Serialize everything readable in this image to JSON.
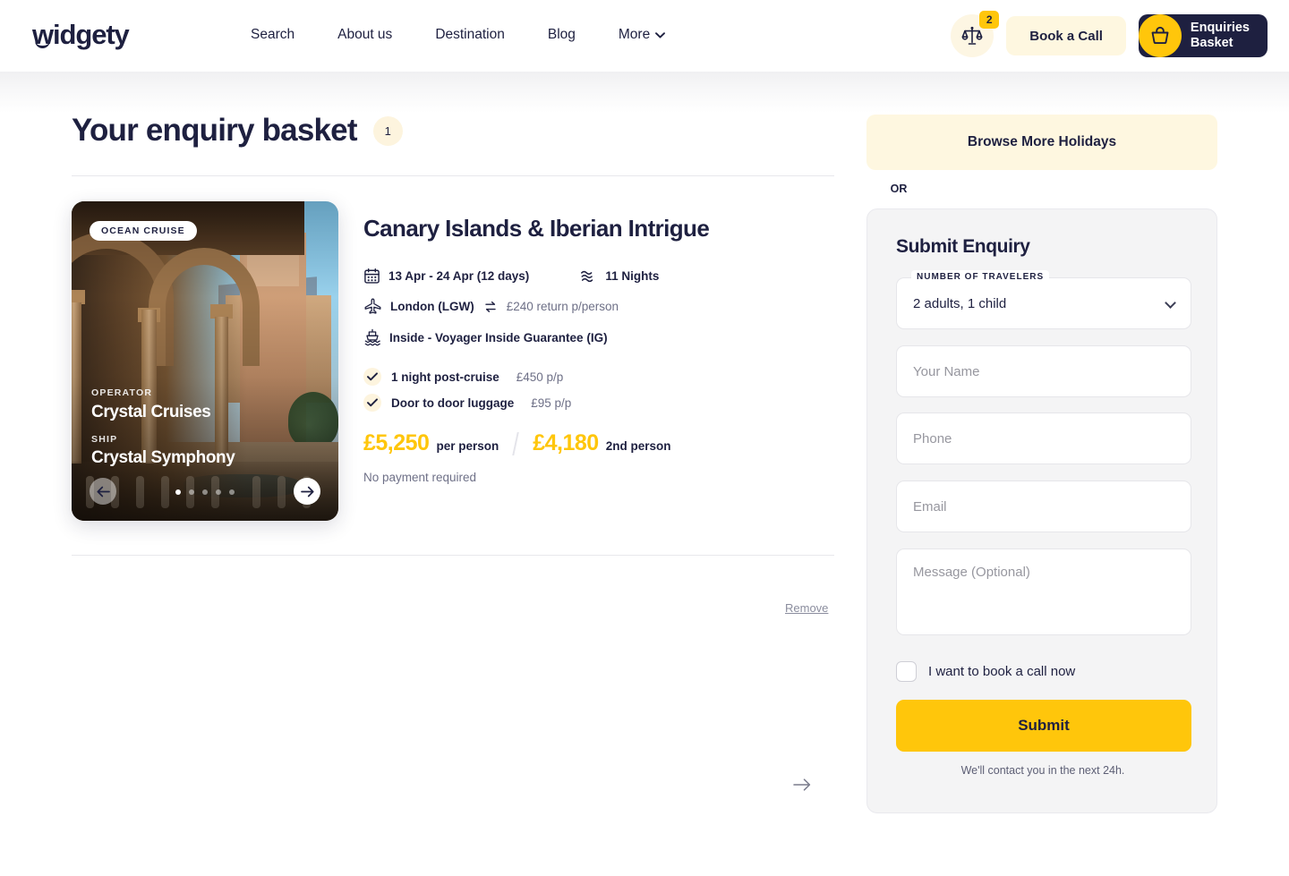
{
  "header": {
    "logo_text": "widgety",
    "nav": [
      {
        "label": "Search",
        "has_chevron": false
      },
      {
        "label": "About us",
        "has_chevron": false
      },
      {
        "label": "Destination",
        "has_chevron": false
      },
      {
        "label": "Blog",
        "has_chevron": false
      },
      {
        "label": "More",
        "has_chevron": true
      }
    ],
    "compare": {
      "icon": "scales-icon",
      "badge_count": "2"
    },
    "book_call_label": "Book a Call",
    "basket": {
      "icon": "basket-icon",
      "line1": "Enquiries",
      "line2": "Basket"
    }
  },
  "main": {
    "page_title": "Your enquiry basket",
    "item_count": "1",
    "next_arrow_icon": "arrow-right-icon"
  },
  "trip": {
    "badge": "OCEAN CRUISE",
    "operator_label": "OPERATOR",
    "operator": "Crystal Cruises",
    "ship_label": "SHIP",
    "ship": "Crystal Symphony",
    "carousel": {
      "total_dots": 5,
      "active_index": 0,
      "prev_icon": "arrow-left-icon",
      "next_icon": "arrow-right-icon"
    },
    "title": "Canary Islands & Iberian Intrigue",
    "dates": "13 Apr - 24 Apr (12 days)",
    "nights": "11 Nights",
    "flight_airport": "London (LGW)",
    "flight_price": "£240 return p/person",
    "cabin": "Inside - Voyager Inside Guarantee (IG)",
    "addons": [
      {
        "name": "1 night post-cruise",
        "price": "£450 p/p"
      },
      {
        "name": "Door to door luggage",
        "price": "£95 p/p"
      }
    ],
    "price_main": "£5,250",
    "price_main_unit": "per person",
    "price_second": "£4,180",
    "price_second_unit": "2nd person",
    "payment_note": "No payment required",
    "remove_label": "Remove"
  },
  "sidebar": {
    "browse_label": "Browse More Holidays",
    "or_label": "OR",
    "panel_title": "Submit Enquiry",
    "travelers_label": "NUMBER OF TRAVELERS",
    "travelers_value": "2 adults, 1 child",
    "name_placeholder": "Your Name",
    "phone_placeholder": "Phone",
    "email_placeholder": "Email",
    "message_placeholder": "Message (Optional)",
    "checkbox_label": "I want to book a call now",
    "submit_label": "Submit",
    "note": "We'll contact you in the next 24h."
  },
  "colors": {
    "accent_yellow": "#FFC60B",
    "navy": "#1e2040",
    "cream": "#FEF7E0",
    "panel_grey": "#f4f4f5"
  }
}
